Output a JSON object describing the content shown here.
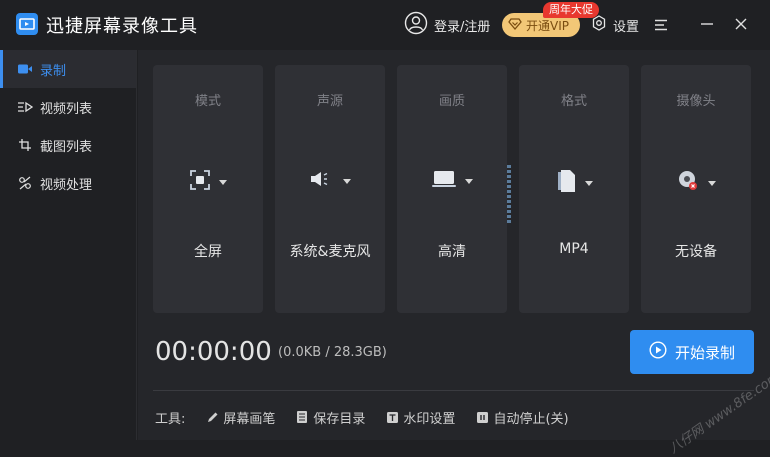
{
  "app": {
    "title": "迅捷屏幕录像工具"
  },
  "titlebar": {
    "login_label": "登录/注册",
    "vip_label": "开通VIP",
    "promo_badge": "周年大促",
    "settings_label": "设置"
  },
  "sidebar": {
    "items": [
      {
        "label": "录制",
        "icon": "video-camera-icon",
        "active": true
      },
      {
        "label": "视频列表",
        "icon": "video-list-icon",
        "active": false
      },
      {
        "label": "截图列表",
        "icon": "screenshot-list-icon",
        "active": false
      },
      {
        "label": "视频处理",
        "icon": "video-tools-icon",
        "active": false
      }
    ]
  },
  "cards": [
    {
      "title": "模式",
      "value": "全屏",
      "icon": "fullscreen-icon"
    },
    {
      "title": "声源",
      "value": "系统&麦克风",
      "icon": "speaker-icon"
    },
    {
      "title": "画质",
      "value": "高清",
      "icon": "monitor-icon"
    },
    {
      "title": "格式",
      "value": "MP4",
      "icon": "file-format-icon"
    },
    {
      "title": "摄像头",
      "value": "无设备",
      "icon": "webcam-disabled-icon"
    }
  ],
  "recording": {
    "timer": "00:00:00",
    "size_info": "(0.0KB / 28.3GB)",
    "start_label": "开始录制"
  },
  "tools": {
    "label": "工具:",
    "items": [
      {
        "label": "屏幕画笔",
        "icon": "pen-icon"
      },
      {
        "label": "保存目录",
        "icon": "folder-doc-icon"
      },
      {
        "label": "水印设置",
        "icon": "watermark-icon"
      },
      {
        "label": "自动停止(关)",
        "icon": "auto-stop-icon"
      }
    ]
  },
  "watermark_text": "八仔网 www.8fe.com",
  "colors": {
    "accent": "#2f8df0",
    "background": "#1f2023",
    "panel": "#25262a",
    "card": "#2f3035",
    "vip": "#f2c777",
    "promo": "#e8382f"
  }
}
